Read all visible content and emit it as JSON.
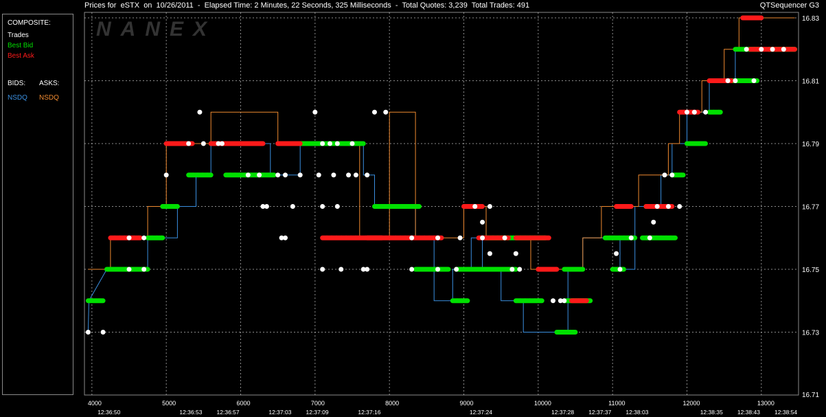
{
  "window": {
    "title": "Prices for  eSTX  on  10/26/2011  -  Elapsed Time: 2 Minutes, 22 Seconds, 325 Milliseconds  -  Total Quotes: 3,239  Total Trades: 491",
    "app_name": "QTSequencer G3",
    "watermark": "NANEX"
  },
  "legend": {
    "composite_header": "COMPOSITE:",
    "trades": "Trades",
    "best_bid": "Best Bid",
    "best_ask": "Best Ask",
    "bids_header": "BIDS:",
    "asks_header": "ASKS:",
    "bid_exchange": "NSDQ",
    "ask_exchange": "NSDQ"
  },
  "colors": {
    "trades": "#ffffff",
    "best_bid": "#00e000",
    "best_ask": "#ff1a1a",
    "nsdq_bid": "#3a8fe0",
    "nsdq_ask": "#f08a30",
    "grid": "#c8c8c8",
    "axis_text": "#ffffff",
    "background": "#000000"
  },
  "chart_data": {
    "type": "line",
    "title": "Prices for eSTX on 10/26/2011",
    "xlabel": "",
    "ylabel": "",
    "xlim": [
      3900,
      13500
    ],
    "ylim": [
      16.71,
      16.83
    ],
    "x_ticks": [
      4000,
      5000,
      6000,
      7000,
      8000,
      9000,
      10000,
      11000,
      12000,
      13000
    ],
    "y_ticks": [
      16.73,
      16.75,
      16.77,
      16.79,
      16.81,
      16.83
    ],
    "y_tick_labels": [
      "16.73",
      "16.75",
      "16.77",
      "16.79",
      "16.81",
      "16.83"
    ],
    "y_bottom_label": "16.71",
    "time_labels": [
      {
        "x": 4230,
        "label": "12:36:50"
      },
      {
        "x": 5330,
        "label": "12:36:53"
      },
      {
        "x": 5830,
        "label": "12:36:57"
      },
      {
        "x": 6530,
        "label": "12:37:03"
      },
      {
        "x": 7030,
        "label": "12:37:09"
      },
      {
        "x": 7730,
        "label": "12:37:16"
      },
      {
        "x": 9230,
        "label": "12:37:24"
      },
      {
        "x": 10330,
        "label": "12:37:28"
      },
      {
        "x": 10830,
        "label": "12:37:37"
      },
      {
        "x": 11330,
        "label": "12:38:03"
      },
      {
        "x": 12330,
        "label": "12:38:35"
      },
      {
        "x": 12830,
        "label": "12:38:43"
      },
      {
        "x": 13330,
        "label": "12:38:54"
      }
    ],
    "grid": true,
    "series": [
      {
        "name": "NSDQ",
        "role": "bid",
        "step": [
          [
            3950,
            16.73
          ],
          [
            3960,
            16.74
          ],
          [
            4200,
            16.75
          ],
          [
            4750,
            16.75
          ],
          [
            4750,
            16.76
          ],
          [
            5150,
            16.76
          ],
          [
            5150,
            16.77
          ],
          [
            5400,
            16.77
          ],
          [
            5400,
            16.78
          ],
          [
            5600,
            16.78
          ],
          [
            5600,
            16.79
          ],
          [
            6400,
            16.79
          ],
          [
            6400,
            16.78
          ],
          [
            6800,
            16.78
          ],
          [
            6800,
            16.79
          ],
          [
            7650,
            16.79
          ],
          [
            7650,
            16.78
          ],
          [
            7800,
            16.78
          ],
          [
            7800,
            16.77
          ],
          [
            8350,
            16.77
          ],
          [
            8350,
            16.76
          ],
          [
            8600,
            16.76
          ],
          [
            8600,
            16.74
          ],
          [
            8850,
            16.74
          ],
          [
            8850,
            16.75
          ],
          [
            9100,
            16.75
          ],
          [
            9100,
            16.76
          ],
          [
            9250,
            16.76
          ],
          [
            9250,
            16.75
          ],
          [
            9500,
            16.75
          ],
          [
            9500,
            16.74
          ],
          [
            9800,
            16.74
          ],
          [
            9800,
            16.73
          ],
          [
            10400,
            16.73
          ],
          [
            10400,
            16.75
          ],
          [
            10600,
            16.75
          ],
          [
            10600,
            16.76
          ],
          [
            11100,
            16.76
          ],
          [
            11100,
            16.75
          ],
          [
            11300,
            16.75
          ],
          [
            11300,
            16.77
          ],
          [
            11650,
            16.77
          ],
          [
            11650,
            16.78
          ],
          [
            11800,
            16.78
          ],
          [
            11800,
            16.79
          ],
          [
            12000,
            16.79
          ],
          [
            12000,
            16.8
          ],
          [
            12300,
            16.8
          ],
          [
            12300,
            16.81
          ],
          [
            12650,
            16.81
          ],
          [
            12650,
            16.82
          ],
          [
            13450,
            16.82
          ]
        ]
      },
      {
        "name": "NSDQ",
        "role": "ask",
        "step": [
          [
            3950,
            16.75
          ],
          [
            4250,
            16.75
          ],
          [
            4250,
            16.76
          ],
          [
            4750,
            16.76
          ],
          [
            4750,
            16.77
          ],
          [
            5000,
            16.77
          ],
          [
            5000,
            16.79
          ],
          [
            5600,
            16.79
          ],
          [
            5600,
            16.8
          ],
          [
            6500,
            16.8
          ],
          [
            6500,
            16.79
          ],
          [
            7600,
            16.79
          ],
          [
            7600,
            16.76
          ],
          [
            8000,
            16.76
          ],
          [
            8000,
            16.8
          ],
          [
            8350,
            16.8
          ],
          [
            8350,
            16.76
          ],
          [
            9000,
            16.76
          ],
          [
            9000,
            16.77
          ],
          [
            9300,
            16.77
          ],
          [
            9300,
            16.76
          ],
          [
            9900,
            16.76
          ],
          [
            9900,
            16.75
          ],
          [
            10600,
            16.75
          ],
          [
            10600,
            16.76
          ],
          [
            10850,
            16.76
          ],
          [
            10850,
            16.77
          ],
          [
            11350,
            16.77
          ],
          [
            11350,
            16.78
          ],
          [
            11750,
            16.78
          ],
          [
            11750,
            16.79
          ],
          [
            11900,
            16.79
          ],
          [
            11900,
            16.8
          ],
          [
            12200,
            16.8
          ],
          [
            12200,
            16.81
          ],
          [
            12500,
            16.81
          ],
          [
            12500,
            16.82
          ],
          [
            12700,
            16.82
          ],
          [
            12700,
            16.83
          ],
          [
            13450,
            16.83
          ]
        ]
      },
      {
        "name": "Best Bid",
        "role": "best_bid",
        "segments": [
          [
            3950,
            4150,
            16.74
          ],
          [
            4200,
            4750,
            16.75
          ],
          [
            4750,
            4950,
            16.76
          ],
          [
            4950,
            5150,
            16.77
          ],
          [
            5300,
            5600,
            16.78
          ],
          [
            5800,
            6450,
            16.78
          ],
          [
            5600,
            6000,
            16.79
          ],
          [
            6800,
            7650,
            16.79
          ],
          [
            7800,
            8400,
            16.77
          ],
          [
            8350,
            8800,
            16.75
          ],
          [
            8850,
            9050,
            16.74
          ],
          [
            8900,
            9700,
            16.75
          ],
          [
            9700,
            10050,
            16.74
          ],
          [
            9300,
            10100,
            16.76
          ],
          [
            10350,
            10700,
            16.74
          ],
          [
            10250,
            10500,
            16.73
          ],
          [
            10350,
            10600,
            16.75
          ],
          [
            10900,
            11300,
            16.76
          ],
          [
            11000,
            11150,
            16.75
          ],
          [
            11400,
            11850,
            16.76
          ],
          [
            11450,
            11700,
            16.77
          ],
          [
            11800,
            11950,
            16.78
          ],
          [
            12000,
            12250,
            16.79
          ],
          [
            12300,
            12450,
            16.8
          ],
          [
            12500,
            12950,
            16.81
          ],
          [
            12650,
            13000,
            16.82
          ],
          [
            13100,
            13450,
            16.82
          ]
        ]
      },
      {
        "name": "Best Ask",
        "role": "best_ask",
        "segments": [
          [
            4250,
            4650,
            16.76
          ],
          [
            5000,
            5350,
            16.79
          ],
          [
            5600,
            6300,
            16.79
          ],
          [
            6500,
            6800,
            16.79
          ],
          [
            7100,
            7900,
            16.76
          ],
          [
            7700,
            8700,
            16.76
          ],
          [
            9000,
            9250,
            16.77
          ],
          [
            9200,
            9600,
            16.76
          ],
          [
            9700,
            10150,
            16.76
          ],
          [
            10000,
            10250,
            16.75
          ],
          [
            10450,
            10650,
            16.74
          ],
          [
            11050,
            11250,
            16.77
          ],
          [
            11450,
            11800,
            16.77
          ],
          [
            11900,
            12150,
            16.8
          ],
          [
            12300,
            12600,
            16.81
          ],
          [
            12850,
            13200,
            16.82
          ],
          [
            12750,
            13000,
            16.83
          ],
          [
            13200,
            13450,
            16.82
          ]
        ]
      },
      {
        "name": "Trades",
        "role": "trades",
        "points": [
          [
            3950,
            16.73
          ],
          [
            4150,
            16.73
          ],
          [
            4500,
            16.76
          ],
          [
            4700,
            16.76
          ],
          [
            4700,
            16.75
          ],
          [
            4500,
            16.75
          ],
          [
            5000,
            16.78
          ],
          [
            5300,
            16.79
          ],
          [
            5450,
            16.8
          ],
          [
            5500,
            16.79
          ],
          [
            5700,
            16.79
          ],
          [
            5750,
            16.79
          ],
          [
            6100,
            16.78
          ],
          [
            6250,
            16.78
          ],
          [
            6500,
            16.78
          ],
          [
            6600,
            16.78
          ],
          [
            6800,
            16.78
          ],
          [
            7050,
            16.78
          ],
          [
            7250,
            16.78
          ],
          [
            7450,
            16.78
          ],
          [
            7550,
            16.78
          ],
          [
            7700,
            16.78
          ],
          [
            6300,
            16.77
          ],
          [
            6350,
            16.77
          ],
          [
            6700,
            16.77
          ],
          [
            6550,
            16.76
          ],
          [
            6600,
            16.76
          ],
          [
            7100,
            16.79
          ],
          [
            7300,
            16.79
          ],
          [
            7500,
            16.79
          ],
          [
            7200,
            16.79
          ],
          [
            7000,
            16.8
          ],
          [
            7100,
            16.77
          ],
          [
            7300,
            16.77
          ],
          [
            7800,
            16.8
          ],
          [
            7950,
            16.8
          ],
          [
            7100,
            16.75
          ],
          [
            7350,
            16.75
          ],
          [
            7650,
            16.75
          ],
          [
            7700,
            16.75
          ],
          [
            8300,
            16.75
          ],
          [
            8650,
            16.75
          ],
          [
            8900,
            16.75
          ],
          [
            8300,
            16.76
          ],
          [
            8650,
            16.76
          ],
          [
            8950,
            16.76
          ],
          [
            9250,
            16.76
          ],
          [
            9550,
            16.76
          ],
          [
            9250,
            16.765
          ],
          [
            9350,
            16.77
          ],
          [
            9700,
            16.755
          ],
          [
            9650,
            16.75
          ],
          [
            9750,
            16.75
          ],
          [
            10200,
            16.74
          ],
          [
            10300,
            16.74
          ],
          [
            10350,
            16.74
          ],
          [
            11050,
            16.755
          ],
          [
            11100,
            16.75
          ],
          [
            11250,
            16.76
          ],
          [
            11500,
            16.76
          ],
          [
            11600,
            16.77
          ],
          [
            11750,
            16.77
          ],
          [
            11900,
            16.77
          ],
          [
            12000,
            16.8
          ],
          [
            12100,
            16.8
          ],
          [
            12250,
            16.8
          ],
          [
            11550,
            16.765
          ],
          [
            11700,
            16.78
          ],
          [
            11800,
            16.78
          ],
          [
            12550,
            16.81
          ],
          [
            12650,
            16.81
          ],
          [
            12900,
            16.81
          ],
          [
            12800,
            16.82
          ],
          [
            13000,
            16.82
          ],
          [
            13150,
            16.82
          ],
          [
            13300,
            16.82
          ],
          [
            9150,
            16.77
          ],
          [
            9350,
            16.755
          ]
        ]
      }
    ]
  }
}
